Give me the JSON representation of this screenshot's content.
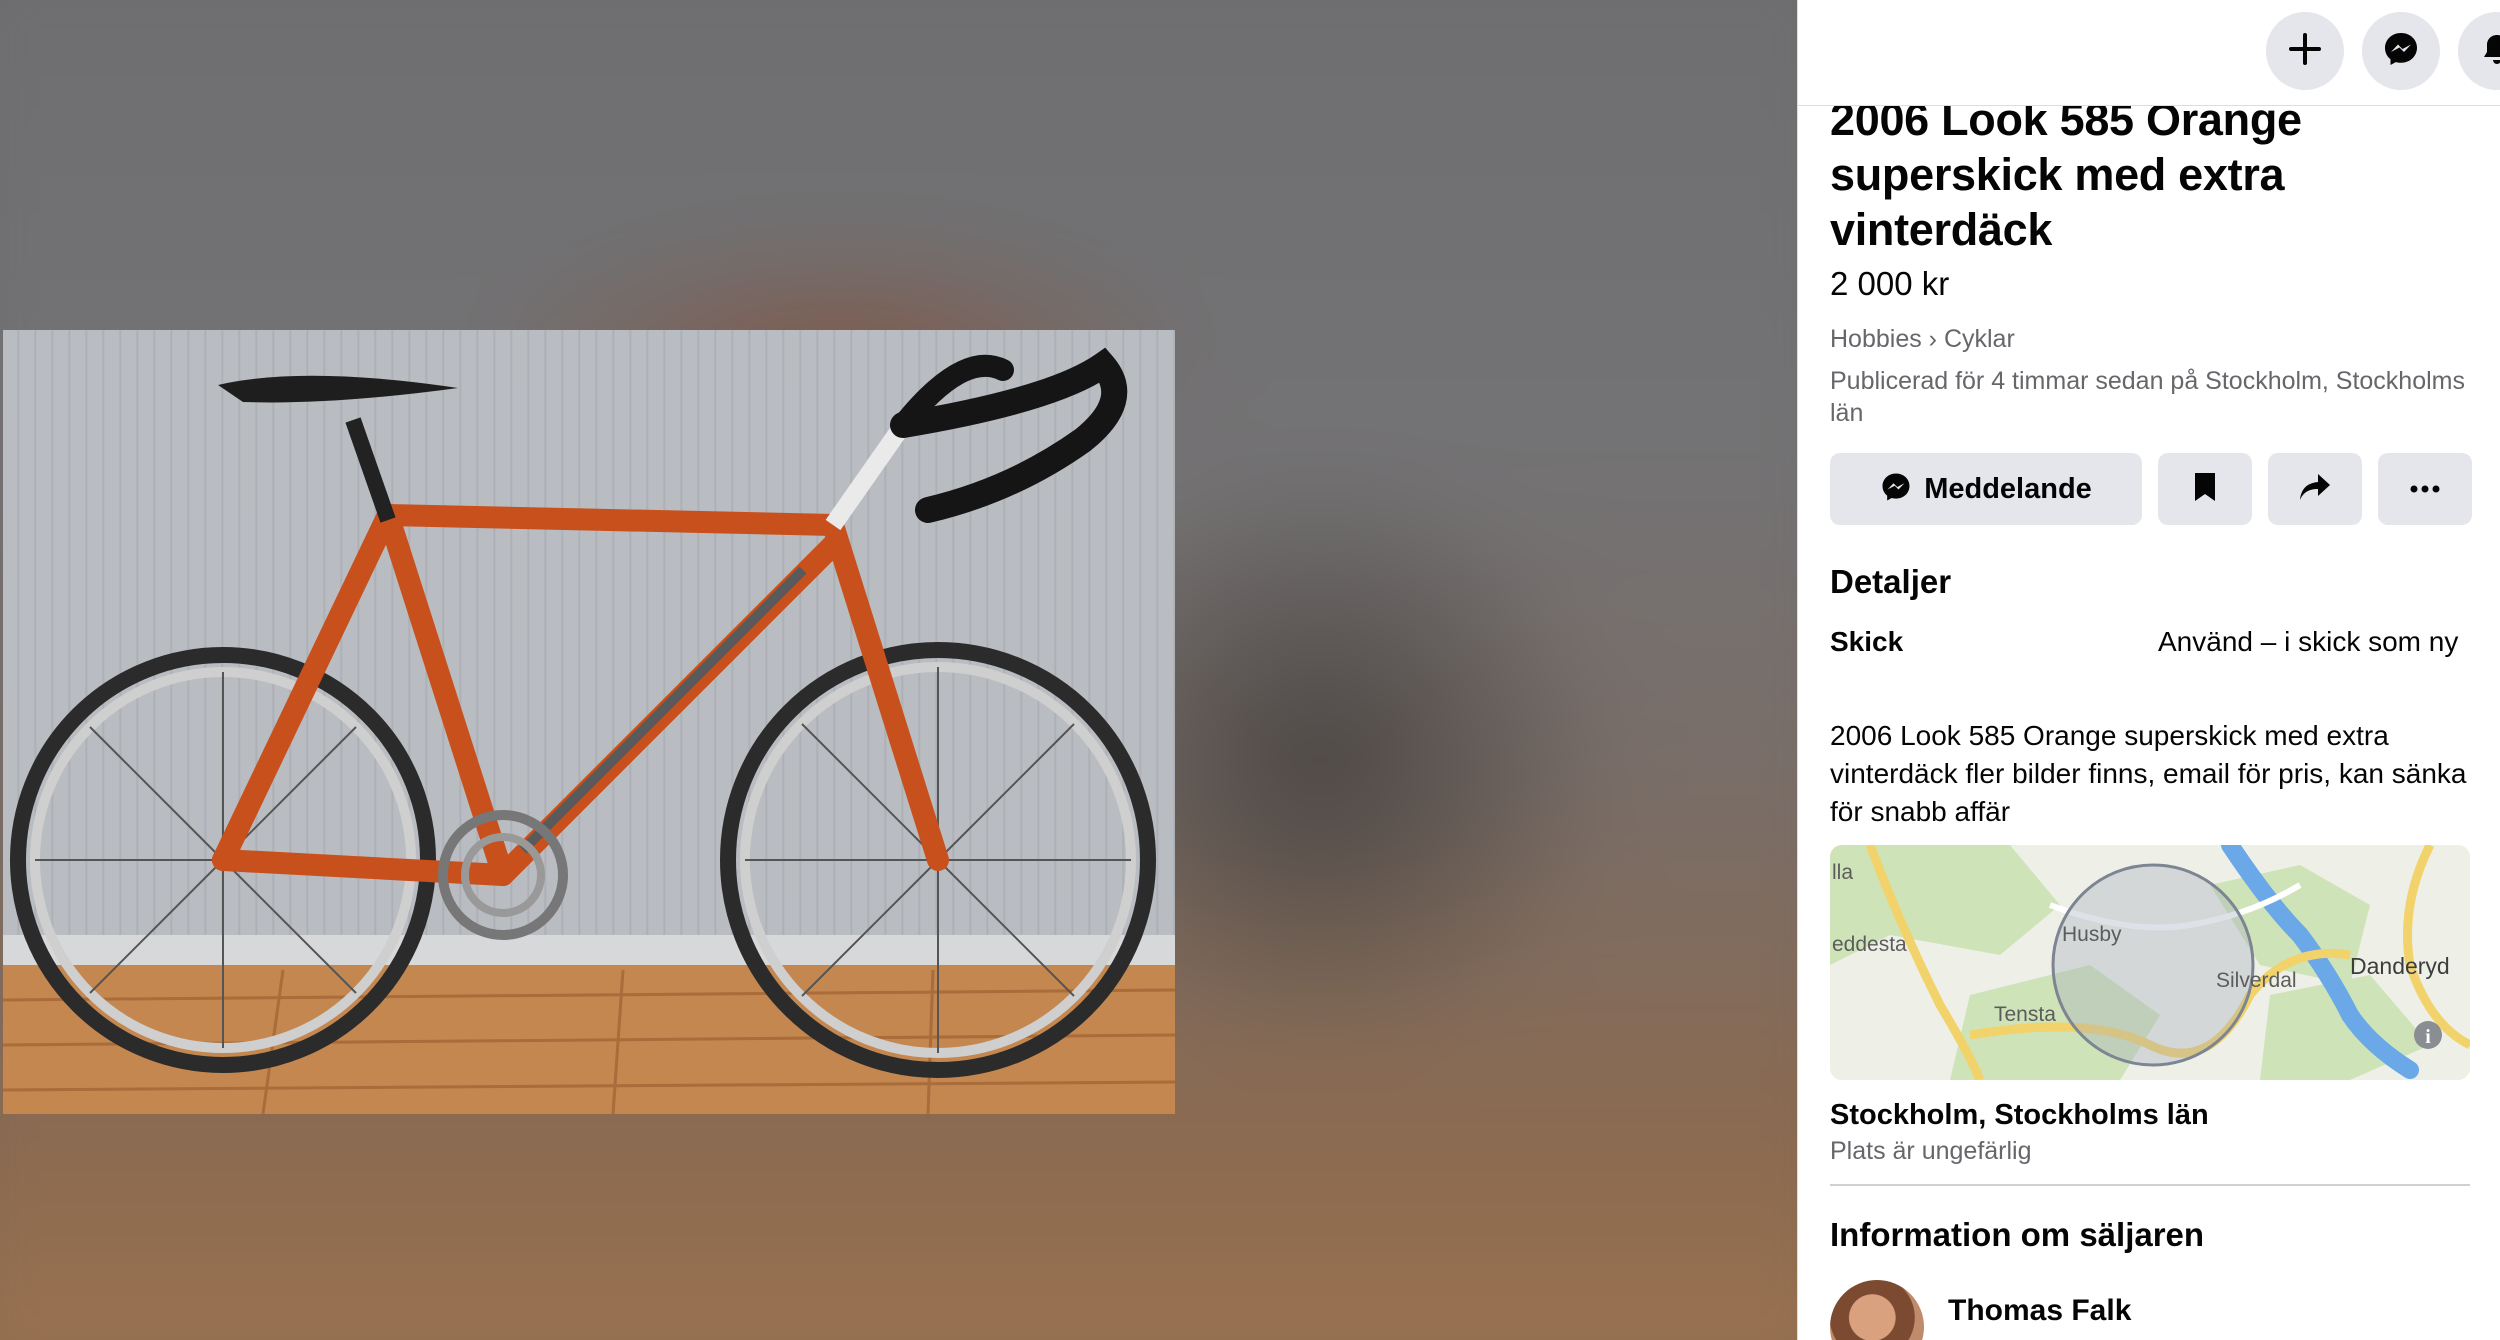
{
  "listing": {
    "title": "2006 Look 585 Orange superskick med extra vinterdäck",
    "price": "2 000 kr",
    "breadcrumb": "Hobbies › Cyklar",
    "published": "Publicerad för 4 timmar sedan på Stockholm, Stockholms län"
  },
  "actions": {
    "message_label": "Meddelande",
    "save_icon": "bookmark-icon",
    "share_icon": "share-icon",
    "more_icon": "more-icon"
  },
  "topbar": {
    "icons": [
      "plus-icon",
      "messenger-icon",
      "bell-icon"
    ]
  },
  "details": {
    "heading": "Detaljer",
    "condition_label": "Skick",
    "condition_value": "Använd – i skick som ny",
    "description": "2006 Look 585 Orange superskick med extra vinterdäck fler bilder finns, email för pris, kan sänka för snabb affär"
  },
  "map": {
    "labels": [
      "lla",
      "eddesta",
      "Husby",
      "Silverdal",
      "Danderyd",
      "Tensta"
    ]
  },
  "location": {
    "name": "Stockholm, Stockholms län",
    "note": "Plats är ungefärlig"
  },
  "seller": {
    "heading": "Information om säljaren",
    "name": "Thomas Falk"
  },
  "colors": {
    "accent_gray": "#e4e6eb",
    "secondary_text": "#65676b",
    "frame_orange": "#c8501c"
  }
}
